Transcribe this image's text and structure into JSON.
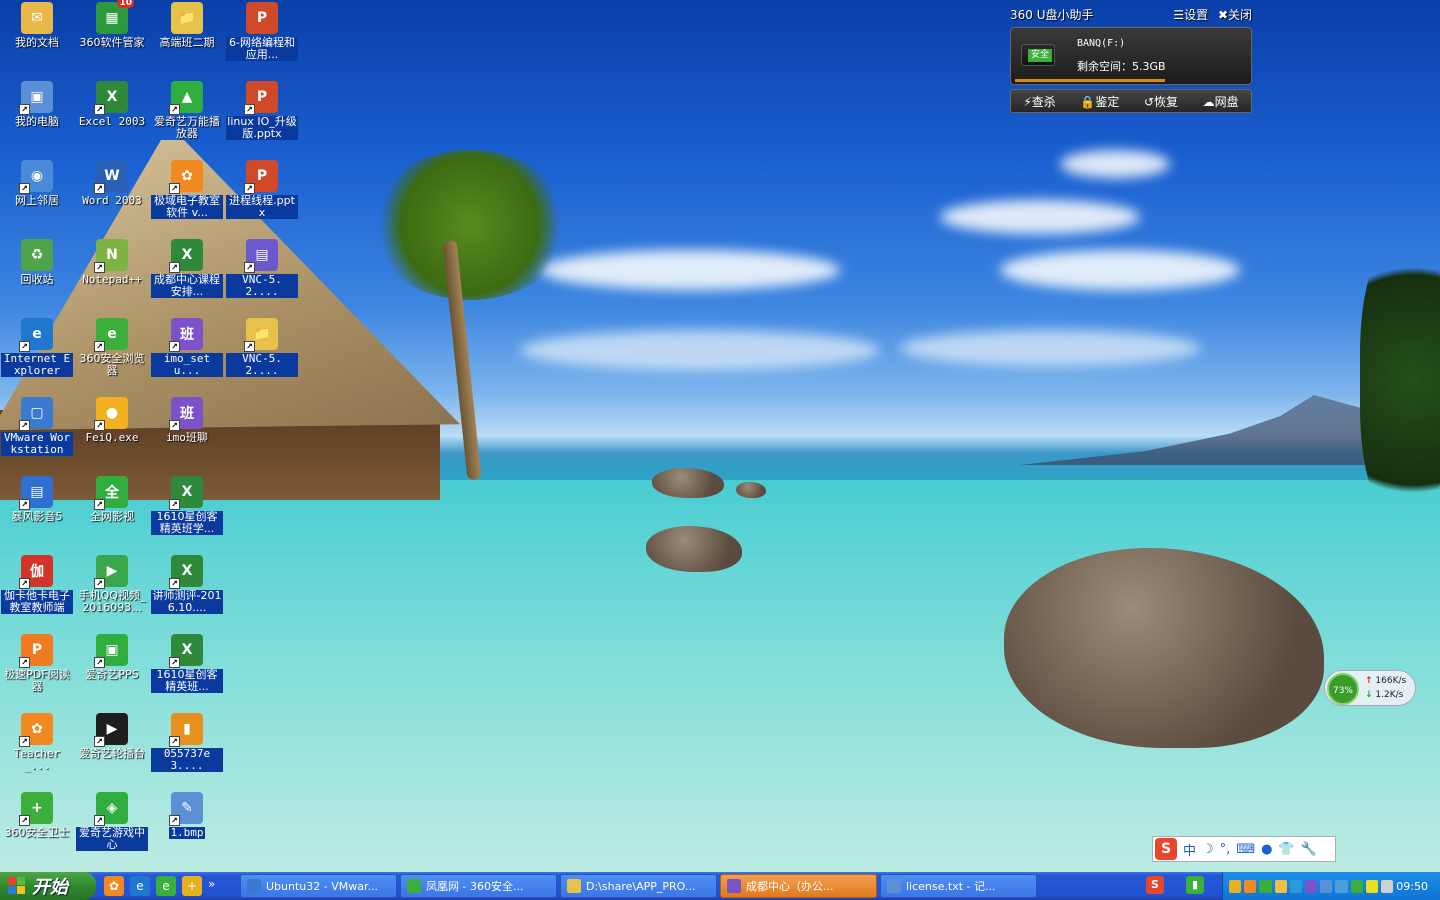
{
  "desktop": {
    "icons": [
      {
        "label": "我的文档",
        "glyph": "✉",
        "color": "#e8b84a"
      },
      {
        "label": "360软件管家",
        "glyph": "▦",
        "color": "#2c9a3c"
      },
      {
        "label": "高端班二期",
        "glyph": "📁",
        "color": "#e6c24a"
      },
      {
        "label": "6-网络编程和应用...",
        "glyph": "P",
        "color": "#d04a2a"
      },
      {
        "label": "我的电脑",
        "glyph": "▣",
        "color": "#5b8fd6"
      },
      {
        "label": "Excel 2003",
        "glyph": "X",
        "color": "#2e8a3a"
      },
      {
        "label": "爱奇艺万能播放器",
        "glyph": "▲",
        "color": "#2fae3f"
      },
      {
        "label": "linux IO_升级版.pptx",
        "glyph": "P",
        "color": "#d04a2a"
      },
      {
        "label": "网上邻居",
        "glyph": "◉",
        "color": "#4a8ad8"
      },
      {
        "label": "Word 2003",
        "glyph": "W",
        "color": "#2a5fb8"
      },
      {
        "label": "极域电子教室软件 v...",
        "glyph": "✿",
        "color": "#f08a20"
      },
      {
        "label": "进程线程.pptx",
        "glyph": "P",
        "color": "#d04a2a"
      },
      {
        "label": "回收站",
        "glyph": "♻",
        "color": "#4fa34a"
      },
      {
        "label": "Notepad++",
        "glyph": "N",
        "color": "#7cb342"
      },
      {
        "label": "成都中心课程安排...",
        "glyph": "X",
        "color": "#2e8a3a"
      },
      {
        "label": "VNC-5.2....",
        "glyph": "▤",
        "color": "#6a5acd"
      },
      {
        "label": "Internet Explorer",
        "glyph": "e",
        "color": "#1f77d0"
      },
      {
        "label": "360安全浏览器",
        "glyph": "e",
        "color": "#3cae3c"
      },
      {
        "label": "imo_setu...",
        "glyph": "班",
        "color": "#7b52c9"
      },
      {
        "label": "VNC-5.2....",
        "glyph": "📁",
        "color": "#e6c24a"
      },
      {
        "label": "VMware Workstation",
        "glyph": "▢",
        "color": "#3a7ad0"
      },
      {
        "label": "FeiQ.exe",
        "glyph": "●",
        "color": "#f2b120"
      },
      {
        "label": "imo班聊",
        "glyph": "班",
        "color": "#7b52c9"
      },
      {
        "label": "暴风影音5",
        "glyph": "▤",
        "color": "#2f6fd0"
      },
      {
        "label": "全网影视",
        "glyph": "全",
        "color": "#2fae3f"
      },
      {
        "label": "1610星创客精英班学...",
        "glyph": "X",
        "color": "#2e8a3a"
      },
      {
        "label": "伽卡他卡电子教室教师端",
        "glyph": "伽",
        "color": "#d2342a"
      },
      {
        "label": "手机QQ视频_2016093...",
        "glyph": "▶",
        "color": "#3aa64a"
      },
      {
        "label": "讲师测评-2016.10....",
        "glyph": "X",
        "color": "#2e8a3a"
      },
      {
        "label": "极速PDF阅读器",
        "glyph": "P",
        "color": "#f07a20"
      },
      {
        "label": "爱奇艺PPS",
        "glyph": "▣",
        "color": "#2fae3f"
      },
      {
        "label": "1610星创客精英班...",
        "glyph": "X",
        "color": "#2e8a3a"
      },
      {
        "label": "Teacher_...",
        "glyph": "✿",
        "color": "#f08a20"
      },
      {
        "label": "爱奇艺轮播台",
        "glyph": "▶",
        "color": "#1e1e1e"
      },
      {
        "label": "055737e3....",
        "glyph": "▮",
        "color": "#e8901e"
      },
      {
        "label": "360安全卫士",
        "glyph": "+",
        "color": "#3cae3c"
      },
      {
        "label": "爱奇艺游戏中心",
        "glyph": "◈",
        "color": "#2fae3f"
      },
      {
        "label": "1.bmp",
        "glyph": "✎",
        "color": "#5b8fd6"
      }
    ],
    "badge": "10"
  },
  "usb_helper": {
    "title": "360 U盘小助手",
    "settings": "☰设置",
    "close": "✖关闭",
    "tag": "安全",
    "drive_name": "BANQ(F:)",
    "space_label": "剩余空间：5.3GB",
    "tools": [
      "⚡查杀",
      "🔒鉴定",
      "↺恢复",
      "☁网盘"
    ]
  },
  "net_meter": {
    "percent": "73%",
    "up": "166K/s",
    "down": "1.2K/s"
  },
  "ime": {
    "logo": "S",
    "mode": "中",
    "items": [
      "☽",
      "°,",
      "⌨",
      "●",
      "👕",
      "🔧"
    ]
  },
  "taskbar": {
    "start_label": "开始",
    "quick_launch": [
      {
        "icon": "360-icon",
        "glyph": "✿",
        "color": "#f08a20"
      },
      {
        "icon": "ie-icon",
        "glyph": "e",
        "color": "#1f77d0"
      },
      {
        "icon": "360browser-icon",
        "glyph": "e",
        "color": "#3cae3c"
      },
      {
        "icon": "360guard-icon",
        "glyph": "+",
        "color": "#e6b020"
      }
    ],
    "overflow": "»",
    "tasks": [
      {
        "label": "Ubuntu32 - VMwar...",
        "color": "#3a7ad0"
      },
      {
        "label": "凤凰网 - 360安全...",
        "color": "#3cae3c"
      },
      {
        "label": "D:\\share\\APP_PRO...",
        "color": "#e6c24a"
      },
      {
        "label": "成都中心（办公...",
        "color": "#7b52c9"
      },
      {
        "label": "license.txt - 记...",
        "color": "#5b8fd6"
      }
    ],
    "tray_mid": [
      {
        "icon": "sogou-icon",
        "glyph": "S",
        "color": "#e8472c"
      },
      {
        "icon": "usb-icon",
        "glyph": "▮",
        "color": "#3cae3c"
      }
    ],
    "tray_icons": [
      "#e8b020",
      "#f08a20",
      "#3cae3c",
      "#f0c040",
      "#2a9ad8",
      "#7b52c9",
      "#5b8fd6",
      "#4aa0d8",
      "#3cae3c",
      "#e8e020",
      "#d0d0d0"
    ],
    "clock": "09:50"
  }
}
